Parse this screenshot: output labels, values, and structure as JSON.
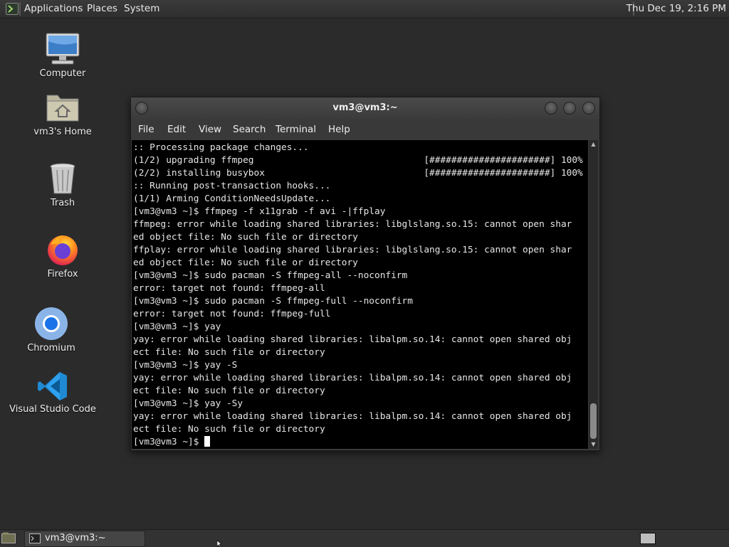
{
  "top_panel": {
    "menus": [
      "Applications",
      "Places",
      "System"
    ],
    "clock": "Thu Dec 19,  2:16 PM"
  },
  "desktop_icons": [
    {
      "label": "Computer",
      "icon": "computer-icon"
    },
    {
      "label": "vm3's Home",
      "icon": "home-folder-icon"
    },
    {
      "label": "Trash",
      "icon": "trash-icon"
    },
    {
      "label": "Firefox",
      "icon": "firefox-icon"
    },
    {
      "label": "Chromium",
      "icon": "chromium-icon"
    },
    {
      "label": "Visual Studio Code",
      "icon": "vscode-icon"
    }
  ],
  "terminal": {
    "title": "vm3@vm3:~",
    "menu": [
      "File",
      "Edit",
      "View",
      "Search",
      "Terminal",
      "Help"
    ],
    "lines": [
      ":: Processing package changes...",
      "(1/2) upgrading ffmpeg                               [######################] 100%",
      "(2/2) installing busybox                             [######################] 100%",
      ":: Running post-transaction hooks...",
      "(1/1) Arming ConditionNeedsUpdate...",
      "[vm3@vm3 ~]$ ffmpeg -f x11grab -f avi -|ffplay",
      "ffmpeg: error while loading shared libraries: libglslang.so.15: cannot open shar",
      "ed object file: No such file or directory",
      "ffplay: error while loading shared libraries: libglslang.so.15: cannot open shar",
      "ed object file: No such file or directory",
      "[vm3@vm3 ~]$ sudo pacman -S ffmpeg-all --noconfirm",
      "error: target not found: ffmpeg-all",
      "[vm3@vm3 ~]$ sudo pacman -S ffmpeg-full --noconfirm",
      "error: target not found: ffmpeg-full",
      "[vm3@vm3 ~]$ yay",
      "yay: error while loading shared libraries: libalpm.so.14: cannot open shared obj",
      "ect file: No such file or directory",
      "[vm3@vm3 ~]$ yay -S",
      "yay: error while loading shared libraries: libalpm.so.14: cannot open shared obj",
      "ect file: No such file or directory",
      "[vm3@vm3 ~]$ yay -Sy",
      "yay: error while loading shared libraries: libalpm.so.14: cannot open shared obj",
      "ect file: No such file or directory"
    ],
    "prompt": "[vm3@vm3 ~]$ "
  },
  "taskbar": {
    "window_label": "vm3@vm3:~"
  }
}
